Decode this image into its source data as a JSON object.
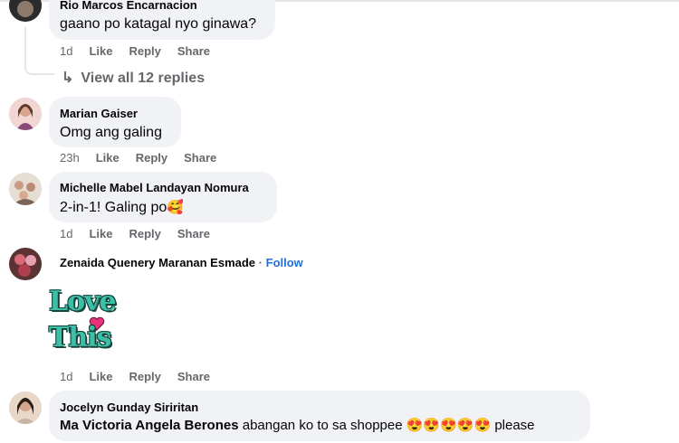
{
  "comments": [
    {
      "author": "Rio Marcos Encarnacion",
      "text": "gaano po katagal nyo ginawa?",
      "time": "1d",
      "like": "Like",
      "reply": "Reply",
      "share": "Share",
      "view_replies": "View all 12 replies"
    },
    {
      "author": "Marian Gaiser",
      "text": "Omg ang galing",
      "time": "23h",
      "like": "Like",
      "reply": "Reply",
      "share": "Share"
    },
    {
      "author": "Michelle Mabel Landayan Nomura",
      "text": "2-in-1! Galing po",
      "emoji": "🥰",
      "time": "1d",
      "like": "Like",
      "reply": "Reply",
      "share": "Share"
    },
    {
      "author": "Zenaida Quenery Maranan Esmade",
      "separator": "·",
      "follow": "Follow",
      "sticker_line1": "Love",
      "sticker_line2": "This",
      "time": "1d",
      "like": "Like",
      "reply": "Reply",
      "share": "Share"
    },
    {
      "author": "Jocelyn Gunday Siriritan",
      "mention": "Ma Victoria Angela Berones",
      "text": "abangan ko to sa shoppee",
      "emojis": "😍😍😍😍😍",
      "text_end": "please"
    }
  ],
  "colors": {
    "bubble": "#f0f2f5",
    "meta": "#65676b",
    "follow": "#216fdb",
    "sticker_teal": "#3bbfa6",
    "sticker_heart": "#e8337c"
  }
}
